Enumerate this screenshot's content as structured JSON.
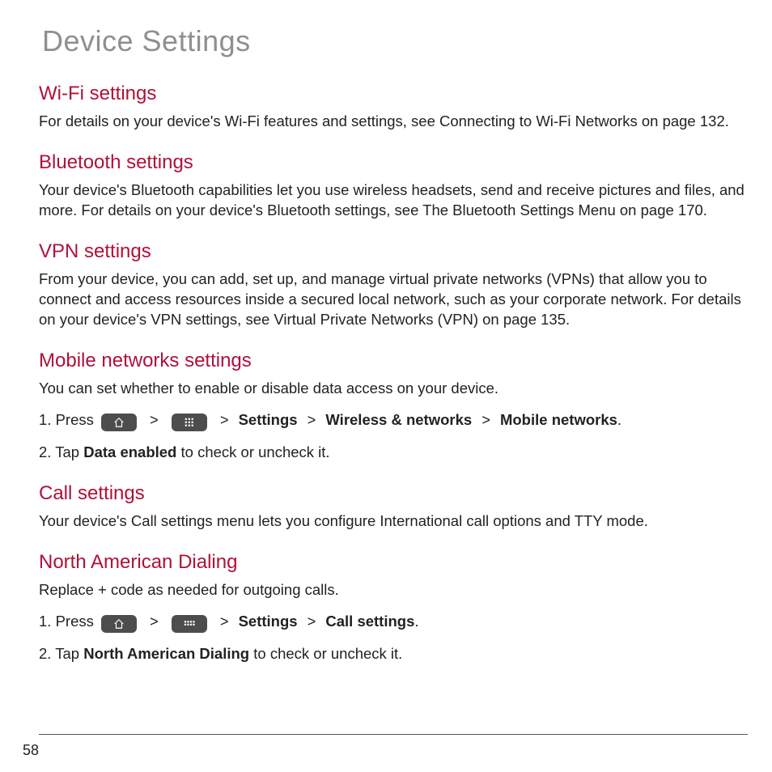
{
  "page_title": "Device Settings",
  "page_number": "58",
  "sections": {
    "wifi": {
      "heading": "Wi-Fi settings",
      "body": "For details on your device's Wi-Fi features and settings, see Connecting to Wi-Fi Networks on page 132."
    },
    "bluetooth": {
      "heading": "Bluetooth settings",
      "body": "Your device's Bluetooth capabilities let you use wireless headsets, send and receive pictures and files, and more. For details on your device's Bluetooth settings, see The Bluetooth Settings Menu on page 170."
    },
    "vpn": {
      "heading": "VPN settings",
      "body": "From your device, you can add, set up, and manage virtual private networks (VPNs) that allow you to connect and access resources inside a secured local network, such as your corporate network. For details on your device's VPN settings, see Virtual Private Networks (VPN) on page 135."
    },
    "mobile": {
      "heading": "Mobile networks settings",
      "body": "You can set whether to enable or disable data access on your device.",
      "step1_prefix": "1. Press ",
      "chev": ">",
      "path_settings": "Settings",
      "path_wireless": "Wireless & networks",
      "path_mobile": "Mobile networks",
      "period": ".",
      "step2_prefix": "2. Tap ",
      "step2_bold": "Data enabled",
      "step2_suffix": " to check or uncheck it."
    },
    "call": {
      "heading": "Call settings",
      "body": "Your device's Call settings menu lets you configure International call options and TTY mode."
    },
    "nad": {
      "heading": "North American Dialing",
      "body": "Replace + code as needed for outgoing calls.",
      "step1_prefix": "1. Press ",
      "chev": ">",
      "path_settings": "Settings",
      "path_call": "Call settings",
      "period": ".",
      "step2_prefix": "2. Tap ",
      "step2_bold": "North American Dialing",
      "step2_suffix": " to check or uncheck it."
    }
  }
}
